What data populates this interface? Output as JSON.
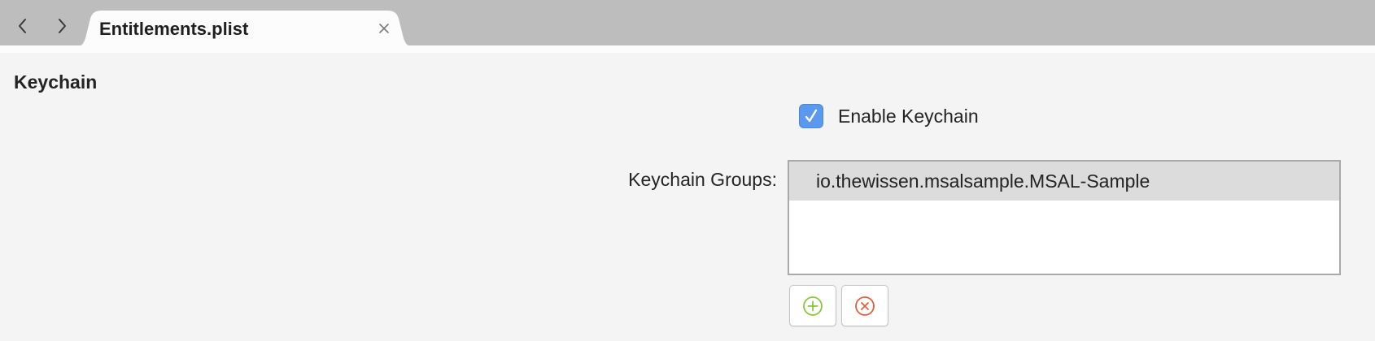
{
  "navigation": {
    "back_icon": "chevron-left-icon",
    "forward_icon": "chevron-right-icon"
  },
  "tab": {
    "title": "Entitlements.plist",
    "close_icon": "close-icon"
  },
  "section": {
    "title": "Keychain"
  },
  "keychain": {
    "enable_checked": true,
    "enable_label": "Enable Keychain",
    "groups_label": "Keychain Groups:",
    "groups": [
      "io.thewissen.msalsample.MSAL-Sample"
    ],
    "add_icon": "add-circle-icon",
    "remove_icon": "remove-circle-icon"
  },
  "colors": {
    "accent": "#5a99ee",
    "add": "#8cc63f",
    "remove": "#e0603f"
  }
}
